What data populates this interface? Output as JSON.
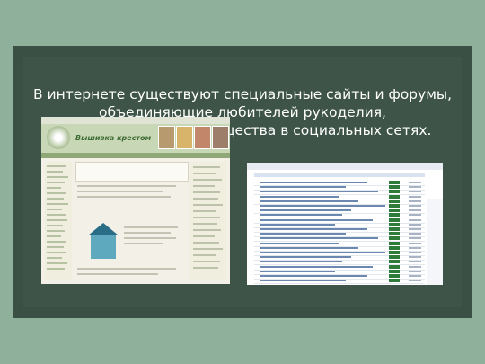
{
  "slide": {
    "heading_lines": [
      "В интернете существуют специальные сайты и форумы,",
      "объединяющие любителей рукоделия,",
      "а также группы и сообщества в социальных сетях."
    ]
  },
  "screenshots": {
    "left": {
      "site_title": "Вышивка крестом"
    },
    "right": {
      "row_count": 22
    }
  },
  "colors": {
    "background": "#8fb19c",
    "slide": "#3a5044",
    "text": "#ffffff"
  }
}
